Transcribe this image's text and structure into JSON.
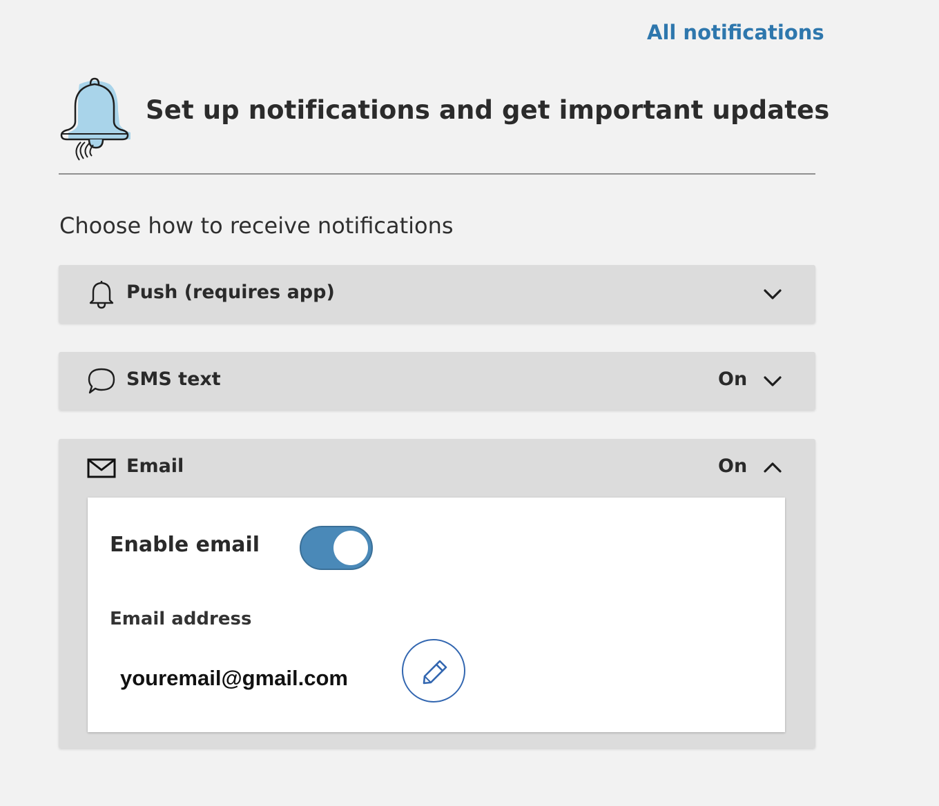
{
  "header": {
    "all_notifications_link": "All notifications",
    "title": "Set up notifications and get important updates"
  },
  "subtitle": "Choose how to receive notifications",
  "channels": [
    {
      "label": "Push (requires app)",
      "status": "",
      "icon": "bell-outline-icon",
      "expanded": false
    },
    {
      "label": "SMS text",
      "status": "On",
      "icon": "speech-bubble-icon",
      "expanded": false
    },
    {
      "label": "Email",
      "status": "On",
      "icon": "envelope-icon",
      "expanded": true
    }
  ],
  "email_settings": {
    "enable_label": "Enable email",
    "enabled": true,
    "address_label": "Email address",
    "address_value": "youremail@gmail.com"
  },
  "colors": {
    "accent": "#2e77ad",
    "toggle_on": "#4a89b8",
    "edit_button": "#3266b0",
    "panel_bg": "#dcdcdc",
    "page_bg": "#f2f2f2"
  }
}
